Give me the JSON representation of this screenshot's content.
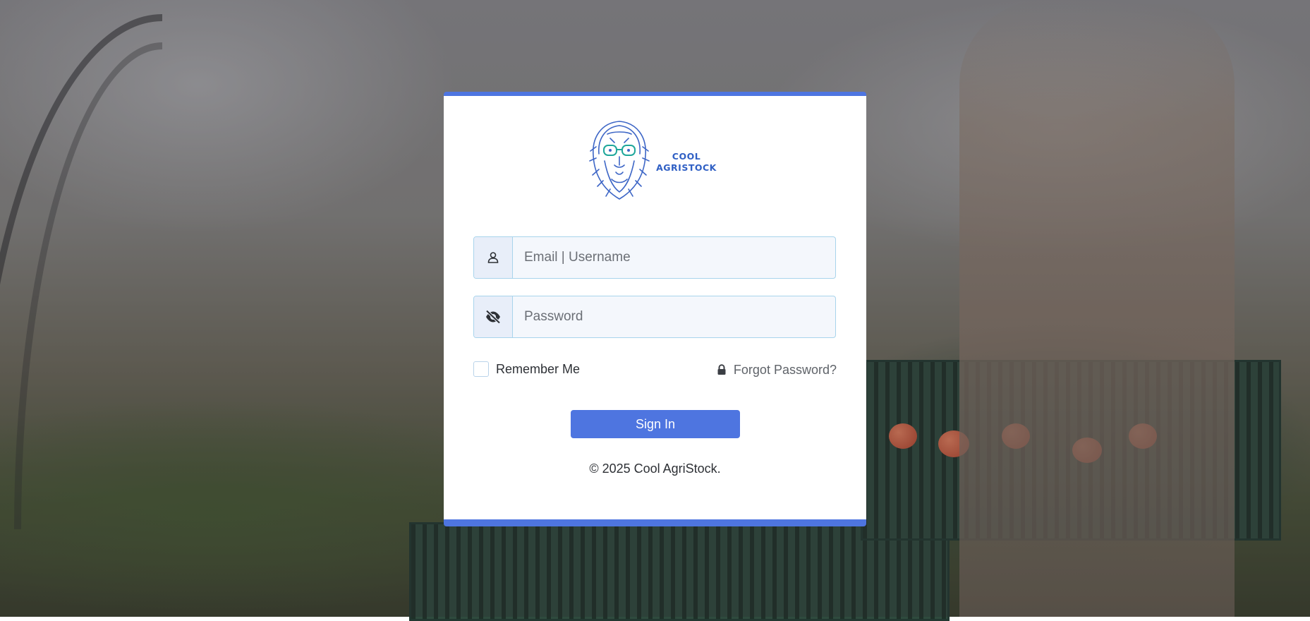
{
  "brand": {
    "logo_text_line1": "COOL",
    "logo_text_line2": "AGRISTOCK",
    "accent_color": "#4e75e0"
  },
  "login": {
    "username": {
      "placeholder": "Email | Username",
      "value": "",
      "icon": "user-icon"
    },
    "password": {
      "placeholder": "Password",
      "value": "",
      "icon": "eye-slash-icon"
    },
    "remember_me_label": "Remember Me",
    "remember_me_checked": false,
    "forgot_password_label": "Forgot Password?",
    "forgot_password_icon": "lock-icon",
    "sign_in_label": "Sign In"
  },
  "footer": {
    "copyright": "© 2025 Cool AgriStock."
  }
}
